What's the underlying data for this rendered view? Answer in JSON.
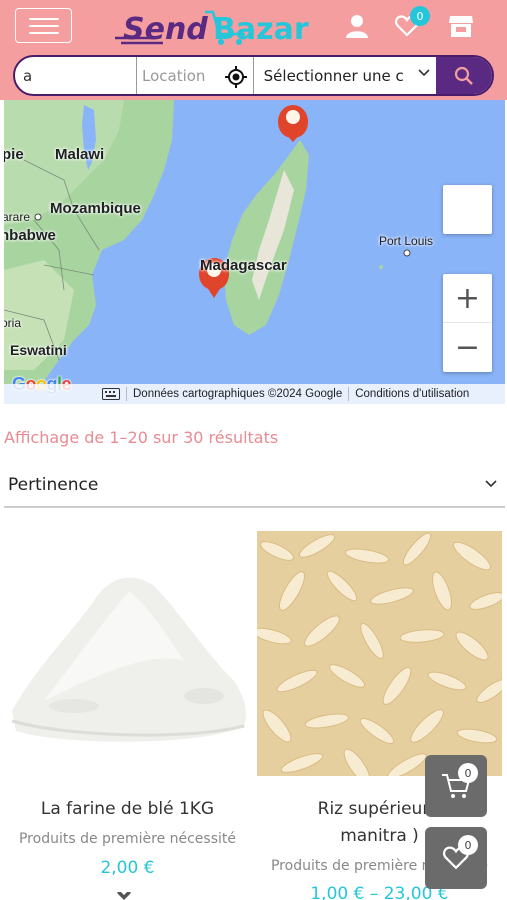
{
  "header": {
    "logo_text_1": "Send",
    "logo_text_2": "Bazar",
    "wishlist_count": "0",
    "colors": {
      "background": "#f59ea0",
      "logo_purple": "#5a2a82",
      "logo_teal": "#26c6da"
    }
  },
  "search": {
    "query_value": "a",
    "location_placeholder": "Location",
    "category_selected": "Sélectionner une c"
  },
  "map": {
    "labels": {
      "malawi": "Malawi",
      "mozambique": "Mozambique",
      "madagascar": "Madagascar",
      "port_louis": "Port Louis",
      "harare_partial": "arare",
      "zimbabwe_partial": "nbabwe",
      "pie_partial": "pie",
      "toria_partial": "oria",
      "eswatini": "Eswatini"
    },
    "google_logo": "Google",
    "attribution": "Données cartographiques ©2024 Google",
    "terms": "Conditions d'utilisation",
    "zoom_in": "+",
    "zoom_out": "−"
  },
  "results": {
    "summary": "Affichage de 1–20 sur 30 résultats",
    "sort_selected": "Pertinence"
  },
  "products": [
    {
      "title": "La farine de blé 1KG",
      "category": "Produits de première nécessité",
      "price": "2,00 €"
    },
    {
      "title_line1": "Riz supérieur (",
      "title_line2": "manitra )",
      "category": "Produits de première nécessité",
      "price": "1,00 € – 23,00 €"
    }
  ],
  "floating": {
    "cart_count": "0",
    "wishlist_count": "0"
  },
  "colors": {
    "accent_pink": "#e88b93",
    "price_teal": "#26c6da",
    "search_button": "#5a2a82"
  }
}
